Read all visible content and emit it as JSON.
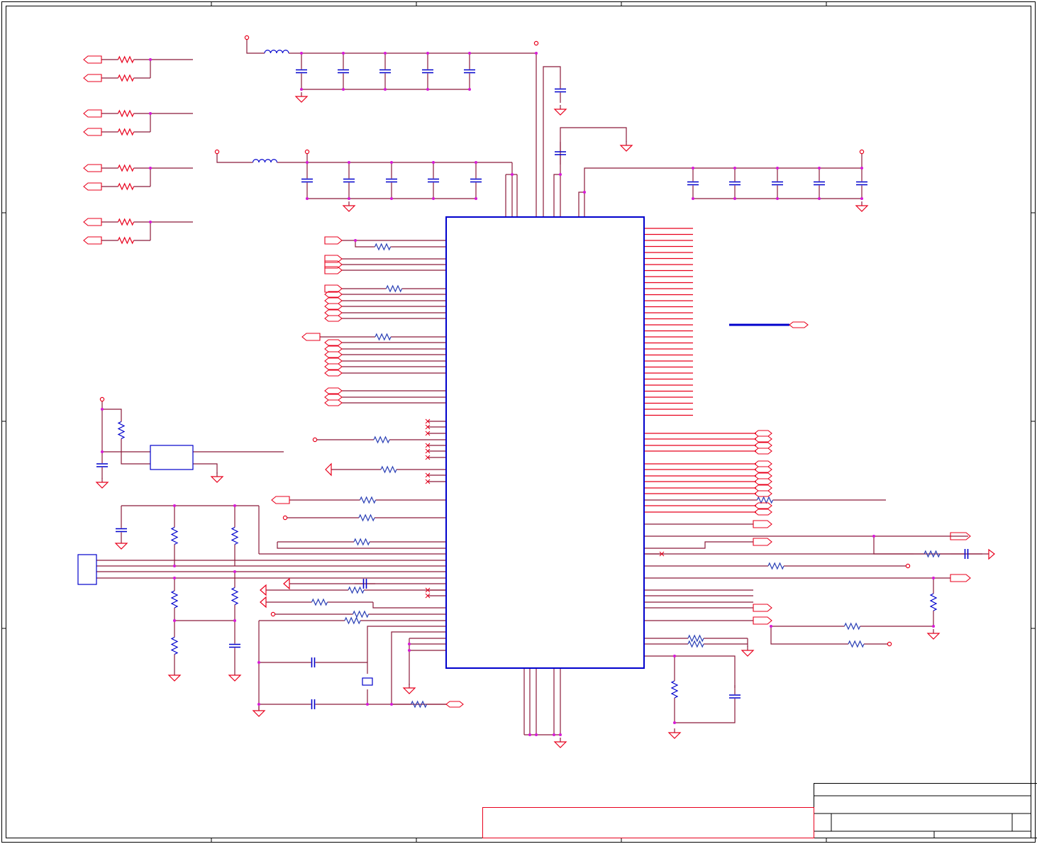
{
  "sheet": {
    "description": "",
    "colors": {
      "wire": "#8b1a3a",
      "component": "#e8001c",
      "body": "#0000cc",
      "junction": "#d61ad6",
      "border": "#000000"
    },
    "title_block": {
      "title": "",
      "document_number": "",
      "revision": "",
      "sheet": ""
    }
  }
}
